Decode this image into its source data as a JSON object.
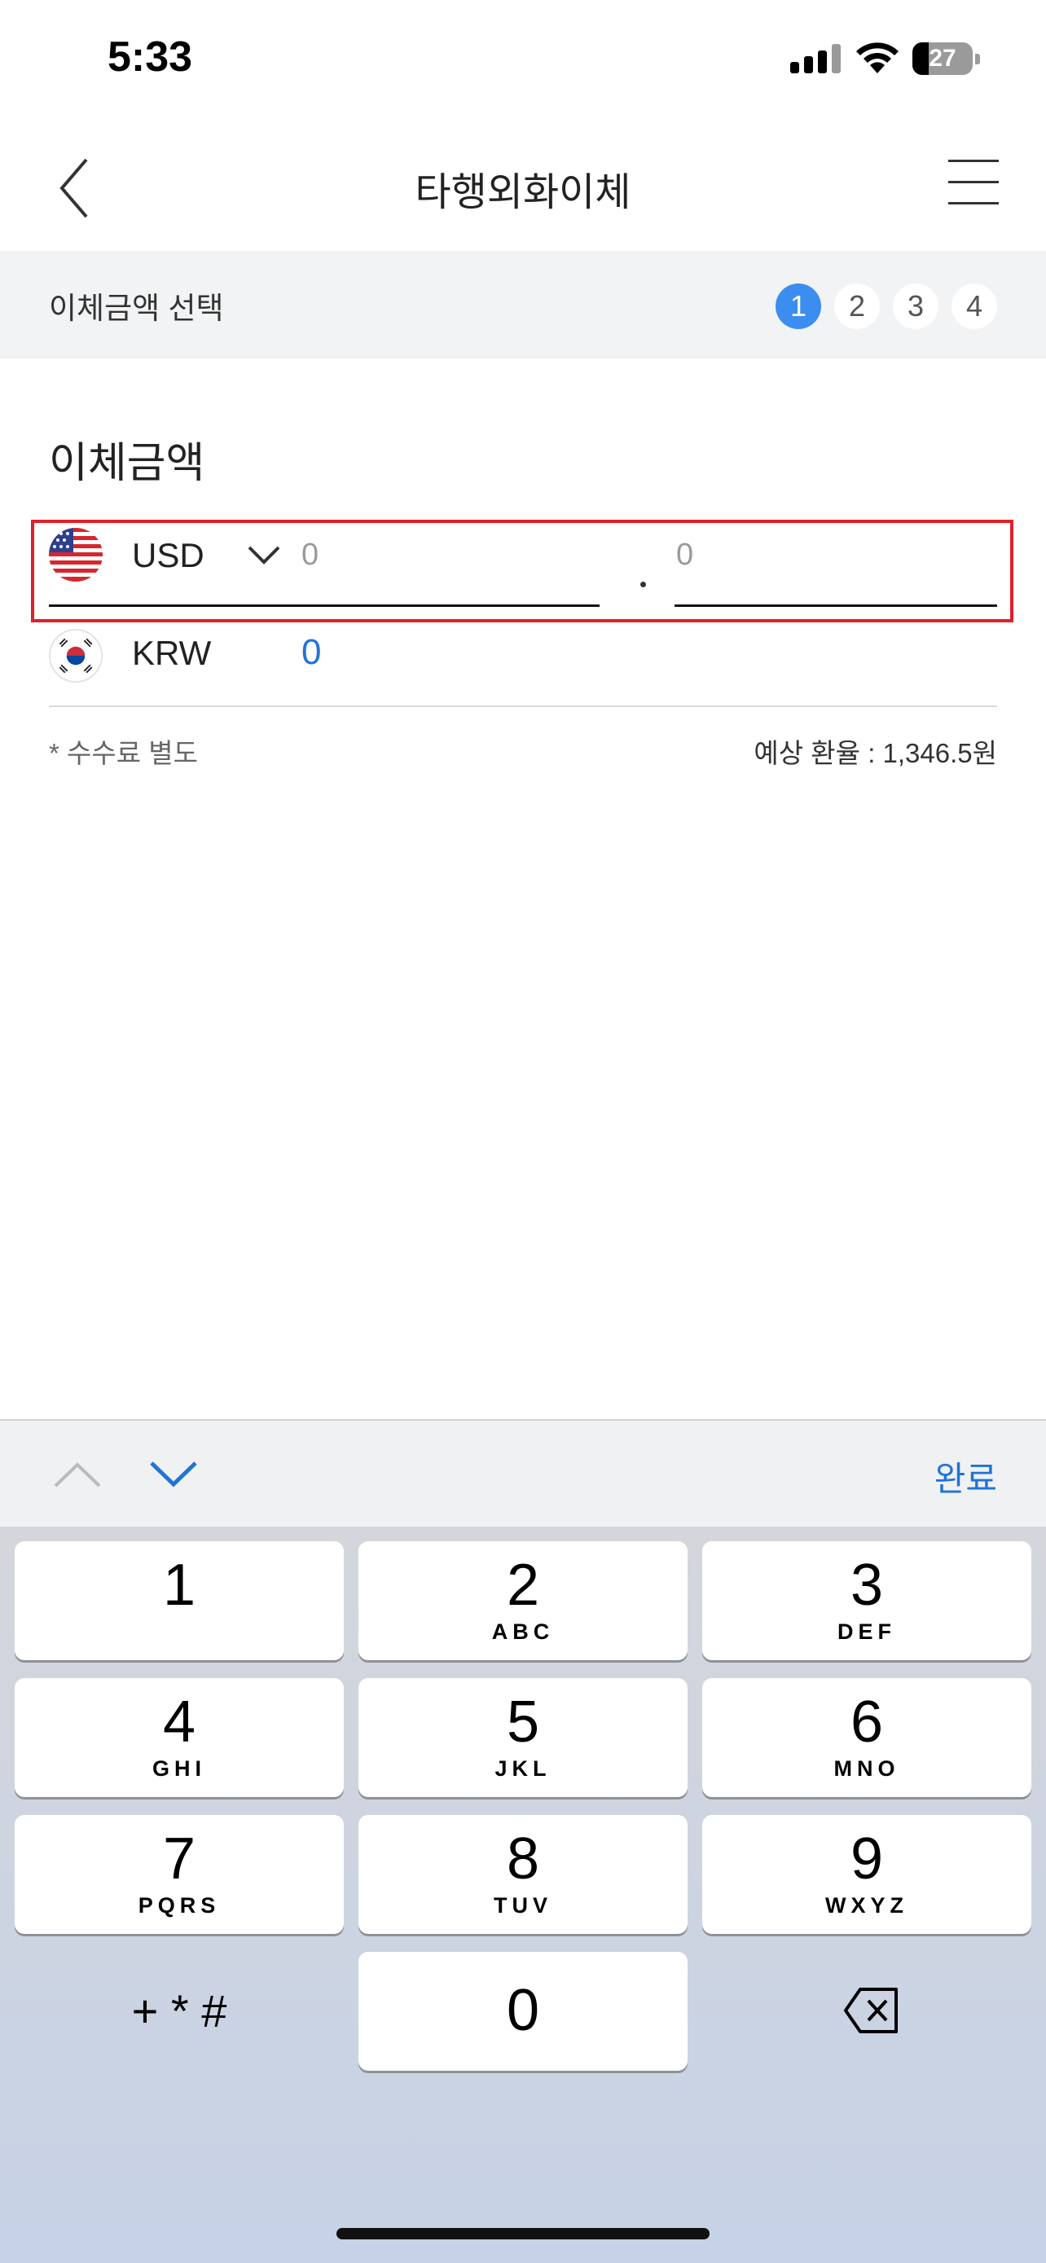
{
  "status_bar": {
    "time": "5:33",
    "battery": "27",
    "battery_percent": 27
  },
  "header": {
    "title": "타행외화이체"
  },
  "step_bar": {
    "label": "이체금액 선택",
    "steps": [
      "1",
      "2",
      "3",
      "4"
    ],
    "active_step": 1
  },
  "section": {
    "title": "이체금액"
  },
  "currency_row": {
    "code": "USD",
    "integer_placeholder": "0",
    "decimal_placeholder": "0"
  },
  "krw_row": {
    "code": "KRW",
    "value": "0"
  },
  "notes": {
    "fee": "* 수수료 별도",
    "rate": "예상 환율 : 1,346.5원"
  },
  "keyboard": {
    "done_label": "완료",
    "keys": [
      {
        "num": "1",
        "letters": ""
      },
      {
        "num": "2",
        "letters": "ABC"
      },
      {
        "num": "3",
        "letters": "DEF"
      },
      {
        "num": "4",
        "letters": "GHI"
      },
      {
        "num": "5",
        "letters": "JKL"
      },
      {
        "num": "6",
        "letters": "MNO"
      },
      {
        "num": "7",
        "letters": "PQRS"
      },
      {
        "num": "8",
        "letters": "TUV"
      },
      {
        "num": "9",
        "letters": "WXYZ"
      }
    ],
    "symbols": "+ * #",
    "zero": "0"
  },
  "colors": {
    "accent": "#1f74d8",
    "step_active": "#3b8ef0",
    "highlight": "#e0202a"
  },
  "icons": {
    "back": "back-chevron-icon",
    "menu": "hamburger-menu-icon",
    "dropdown": "chevron-down-icon",
    "prev": "chevron-up-icon",
    "next": "chevron-down-icon",
    "delete": "backspace-icon"
  }
}
